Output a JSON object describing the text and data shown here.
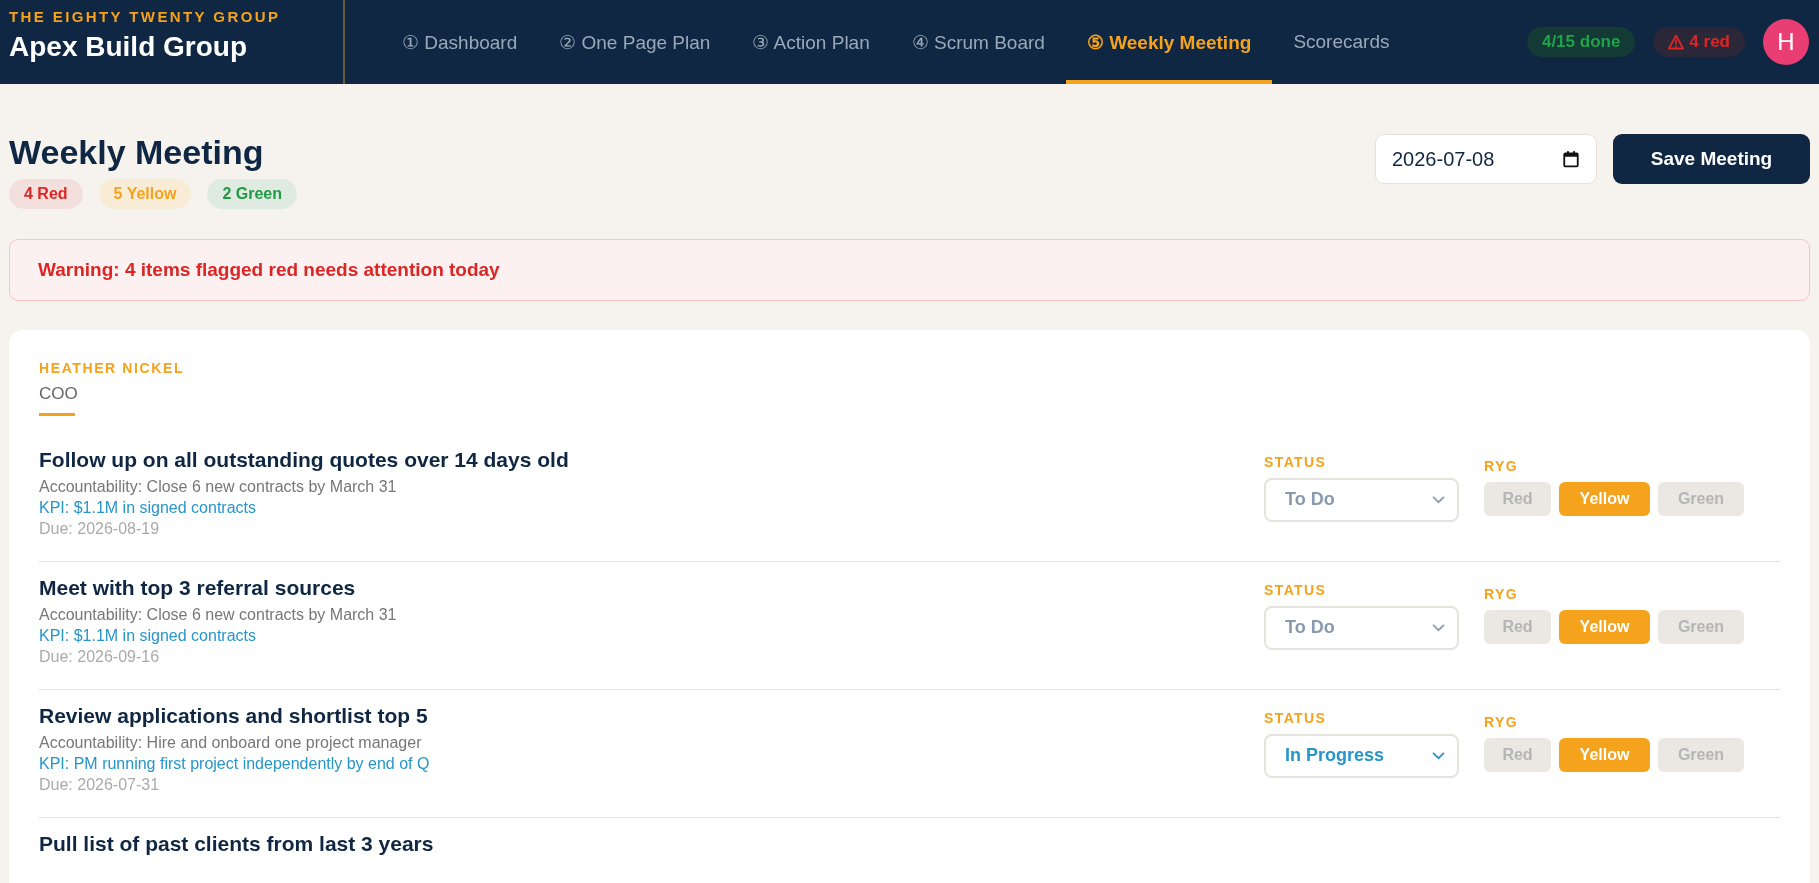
{
  "brand": {
    "group": "THE EIGHTY TWENTY GROUP",
    "company": "Apex Build Group"
  },
  "nav": [
    {
      "label": "① Dashboard",
      "selected": false
    },
    {
      "label": "② One Page Plan",
      "selected": false
    },
    {
      "label": "③ Action Plan",
      "selected": false
    },
    {
      "label": "④ Scrum Board",
      "selected": false
    },
    {
      "label": "⑤ Weekly Meeting",
      "selected": true
    },
    {
      "label": "Scorecards",
      "selected": false
    }
  ],
  "header_badges": {
    "done": "4/15 done",
    "red": "4 red"
  },
  "avatar": {
    "initial": "H"
  },
  "page": {
    "title": "Weekly Meeting",
    "date": "2026-07-08",
    "save_button": "Save Meeting"
  },
  "counts": [
    {
      "label": "4 Red",
      "kind": "red"
    },
    {
      "label": "5 Yellow",
      "kind": "yellow"
    },
    {
      "label": "2 Green",
      "kind": "green"
    }
  ],
  "warning": "Warning: 4 items flagged red needs attention today",
  "person": {
    "name": "HEATHER NICKEL",
    "role": "COO"
  },
  "items": [
    {
      "title": "Follow up on all outstanding quotes over 14 days old",
      "accountability": "Accountability: Close 6 new contracts by March 31",
      "kpi": "KPI: $1.1M in signed contracts",
      "due": "Due: 2026-08-19",
      "status_label": "STATUS",
      "status": {
        "label": "To Do",
        "kind": "todo"
      },
      "ryg_label": "RYG",
      "ryg": [
        {
          "label": "Red",
          "kind": "red",
          "selected": false
        },
        {
          "label": "Yellow",
          "kind": "yellow",
          "selected": true
        },
        {
          "label": "Green",
          "kind": "green",
          "selected": false
        }
      ]
    },
    {
      "title": "Meet with top 3 referral sources",
      "accountability": "Accountability: Close 6 new contracts by March 31",
      "kpi": "KPI: $1.1M in signed contracts",
      "due": "Due: 2026-09-16",
      "status_label": "STATUS",
      "status": {
        "label": "To Do",
        "kind": "todo"
      },
      "ryg_label": "RYG",
      "ryg": [
        {
          "label": "Red",
          "kind": "red",
          "selected": false
        },
        {
          "label": "Yellow",
          "kind": "yellow",
          "selected": true
        },
        {
          "label": "Green",
          "kind": "green",
          "selected": false
        }
      ]
    },
    {
      "title": "Review applications and shortlist top 5",
      "accountability": "Accountability: Hire and onboard one project manager",
      "kpi": "KPI: PM running first project independently by end of Q",
      "due": "Due: 2026-07-31",
      "status_label": "STATUS",
      "status": {
        "label": "In Progress",
        "kind": "progress"
      },
      "ryg_label": "RYG",
      "ryg": [
        {
          "label": "Red",
          "kind": "red",
          "selected": false
        },
        {
          "label": "Yellow",
          "kind": "yellow",
          "selected": true
        },
        {
          "label": "Green",
          "kind": "green",
          "selected": false
        }
      ]
    },
    {
      "title": "Pull list of past clients from last 3 years"
    }
  ]
}
